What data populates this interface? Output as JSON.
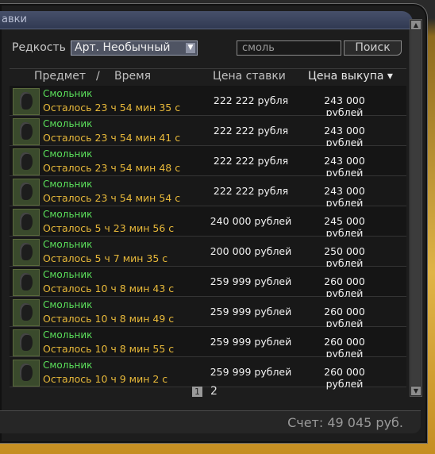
{
  "window": {
    "title": "авки"
  },
  "filter": {
    "rarity_label": "Редкость",
    "rarity_value": "Арт. Необычный",
    "search_value": "смоль",
    "search_button": "Поиск"
  },
  "columns": {
    "item": "Предмет",
    "sep": "/",
    "time": "Время",
    "bid": "Цена ставки",
    "buyout": "Цена выкупа ▾"
  },
  "rows": [
    {
      "name": "Смольник",
      "time": "Осталось 23 ч 54 мин 35 с",
      "bid": "222 222 рубля",
      "buyout": "243 000 рублей"
    },
    {
      "name": "Смольник",
      "time": "Осталось 23 ч 54 мин 41 с",
      "bid": "222 222 рубля",
      "buyout": "243 000 рублей"
    },
    {
      "name": "Смольник",
      "time": "Осталось 23 ч 54 мин 48 с",
      "bid": "222 222 рубля",
      "buyout": "243 000 рублей"
    },
    {
      "name": "Смольник",
      "time": "Осталось 23 ч 54 мин 54 с",
      "bid": "222 222 рубля",
      "buyout": "243 000 рублей"
    },
    {
      "name": "Смольник",
      "time": "Осталось 5 ч 23 мин 56 с",
      "bid": "240 000 рублей",
      "buyout": "245 000 рублей"
    },
    {
      "name": "Смольник",
      "time": "Осталось 5 ч 7 мин 35 с",
      "bid": "200 000 рублей",
      "buyout": "250 000 рублей"
    },
    {
      "name": "Смольник",
      "time": "Осталось 10 ч 8 мин 43 с",
      "bid": "259 999 рублей",
      "buyout": "260 000 рублей"
    },
    {
      "name": "Смольник",
      "time": "Осталось 10 ч 8 мин 49 с",
      "bid": "259 999 рублей",
      "buyout": "260 000 рублей"
    },
    {
      "name": "Смольник",
      "time": "Осталось 10 ч 8 мин 55 с",
      "bid": "259 999 рублей",
      "buyout": "260 000 рублей"
    },
    {
      "name": "Смольник",
      "time": "Осталось 10 ч 9 мин 2 с",
      "bid": "259 999 рублей",
      "buyout": "260 000 рублей"
    }
  ],
  "pagination": {
    "current": "1",
    "next": "2"
  },
  "footer": {
    "balance": "Счет: 49 045 руб."
  },
  "icons": {
    "item": "resin-artifact-icon",
    "dropdown": "chevron-down-icon",
    "scroll_up": "arrow-up-icon",
    "scroll_down": "arrow-down-icon"
  },
  "colors": {
    "item_name": "#5be05b",
    "time_left": "#e8b93a",
    "title_bar": "#3c4560",
    "frame_gold": "#e0b447"
  }
}
